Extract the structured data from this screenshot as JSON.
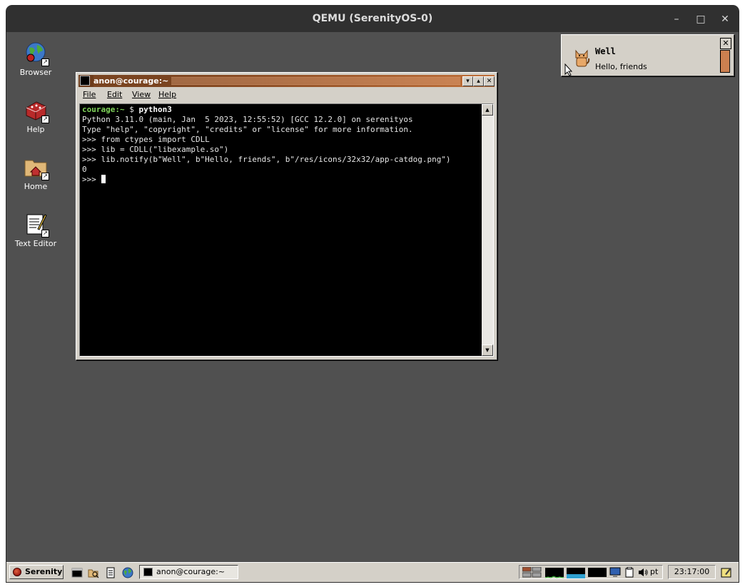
{
  "host": {
    "title": "QEMU (SerenityOS-0)",
    "minimize_glyph": "–",
    "maximize_glyph": "□",
    "close_glyph": "✕"
  },
  "desktop_icons": [
    {
      "label": "Browser",
      "icon": "browser-icon"
    },
    {
      "label": "Help",
      "icon": "help-icon"
    },
    {
      "label": "Home",
      "icon": "home-folder-icon"
    },
    {
      "label": "Text Editor",
      "icon": "text-editor-icon"
    }
  ],
  "terminal": {
    "title": "anon@courage:~",
    "menu": [
      "File",
      "Edit",
      "View",
      "Help"
    ],
    "prompt_user": "courage:~",
    "prompt_symbol": " $ ",
    "command": "python3",
    "lines": [
      "Python 3.11.0 (main, Jan  5 2023, 12:55:52) [GCC 12.2.0] on serenityos",
      "Type \"help\", \"copyright\", \"credits\" or \"license\" for more information.",
      ">>> from ctypes import CDLL",
      ">>> lib = CDLL(\"libexample.so\")",
      ">>> lib.notify(b\"Well\", b\"Hello, friends\", b\"/res/icons/32x32/app-catdog.png\")",
      "0"
    ],
    "final_prompt": ">>> "
  },
  "notification": {
    "title": "Well",
    "body": "Hello, friends",
    "icon": "catdog-icon"
  },
  "taskbar": {
    "start_label": "Serenity",
    "task_label": "anon@courage:~",
    "keyboard_layout": "pt",
    "clock": "23:17:00"
  },
  "colors": {
    "desktop": "#505050",
    "title_active": "#8a4b22",
    "prompt_green": "#7fd45a"
  }
}
